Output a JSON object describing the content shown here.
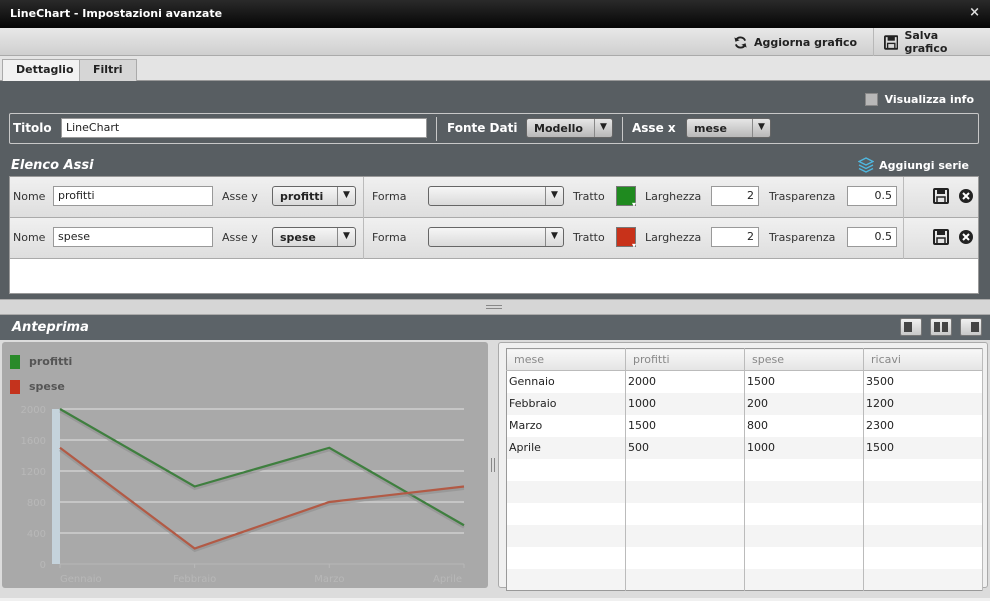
{
  "window": {
    "title": "LineChart - Impostazioni avanzate",
    "close_glyph": "×"
  },
  "toolbar": {
    "refresh_label": "Aggiorna grafico",
    "save_label": "Salva grafico"
  },
  "tabs": [
    {
      "label": "Dettaglio",
      "active": true
    },
    {
      "label": "Filtri",
      "active": false
    }
  ],
  "settings": {
    "show_info_label": "Visualizza info",
    "title_label": "Titolo",
    "title_value": "LineChart",
    "source_label": "Fonte Dati",
    "source_value": "Modello",
    "xaxis_label": "Asse x",
    "xaxis_value": "mese"
  },
  "axes": {
    "section_title": "Elenco Assi",
    "add_series_label": "Aggiungi serie",
    "labels": {
      "name": "Nome",
      "yaxis": "Asse y",
      "shape": "Forma",
      "stroke": "Tratto",
      "width": "Larghezza",
      "transparency": "Trasparenza"
    },
    "rows": [
      {
        "name": "profitti",
        "yaxis": "profitti",
        "shape": "",
        "color": "#1f8a1f",
        "width": "2",
        "transparency": "0.5"
      },
      {
        "name": "spese",
        "yaxis": "spese",
        "shape": "",
        "color": "#c8321a",
        "width": "2",
        "transparency": "0.5"
      }
    ]
  },
  "preview": {
    "title": "Anteprima",
    "legend": [
      {
        "name": "profitti",
        "color": "#2a8a2a"
      },
      {
        "name": "spese",
        "color": "#c4331d"
      }
    ]
  },
  "table": {
    "headers": [
      "mese",
      "profitti",
      "spese",
      "ricavi"
    ],
    "rows": [
      [
        "Gennaio",
        "2000",
        "1500",
        "3500"
      ],
      [
        "Febbraio",
        "1000",
        "200",
        "1200"
      ],
      [
        "Marzo",
        "1500",
        "800",
        "2300"
      ],
      [
        "Aprile",
        "500",
        "1000",
        "1500"
      ]
    ],
    "empty_rows": 6
  },
  "chart_data": {
    "type": "line",
    "categories": [
      "Gennaio",
      "Febbraio",
      "Marzo",
      "Aprile"
    ],
    "series": [
      {
        "name": "profitti",
        "values": [
          2000,
          1000,
          1500,
          500
        ],
        "color": "#3f7f3f"
      },
      {
        "name": "spese",
        "values": [
          1500,
          200,
          800,
          1000
        ],
        "color": "#b25a45"
      }
    ],
    "ylim": [
      0,
      2000
    ],
    "yticks": [
      "0",
      "400",
      "800",
      "1200",
      "1600",
      "2000"
    ],
    "grid": true
  }
}
